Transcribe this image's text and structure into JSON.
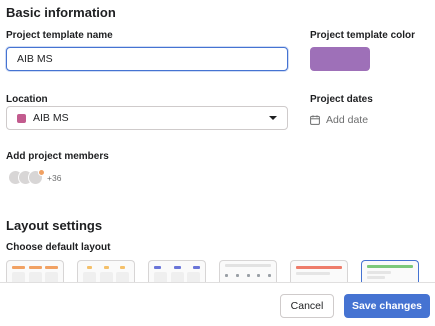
{
  "basic": {
    "section_title": "Basic information",
    "name_label": "Project template name",
    "name_value": "AIB MS",
    "color_label": "Project template color",
    "color_value": "#9e70b8",
    "location_label": "Location",
    "location_value": "AIB MS",
    "location_color": "#c25b8e",
    "dates_label": "Project dates",
    "add_date": "Add date",
    "members_label": "Add project members",
    "members_extra": "+36"
  },
  "layout": {
    "section_title": "Layout settings",
    "choose_label": "Choose default layout",
    "options": [
      {
        "name": "list",
        "accent": "#f1a163"
      },
      {
        "name": "board",
        "accent": "#f4c06a"
      },
      {
        "name": "timeline",
        "accent": "#6a75d8"
      },
      {
        "name": "calendar",
        "accent": "#9aa0a6"
      },
      {
        "name": "gantt",
        "accent": "#ee7c6a"
      },
      {
        "name": "overview",
        "accent": "#7cc97a"
      }
    ]
  },
  "footer": {
    "cancel_label": "Cancel",
    "save_label": "Save changes"
  }
}
